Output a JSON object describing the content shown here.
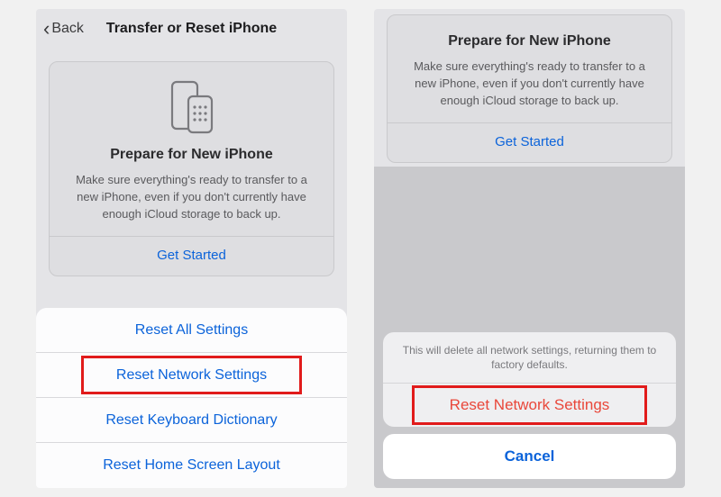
{
  "left": {
    "back_label": "Back",
    "title": "Transfer or Reset iPhone",
    "card": {
      "title": "Prepare for New iPhone",
      "desc": "Make sure everything's ready to transfer to a new iPhone, even if you don't currently have enough iCloud storage to back up.",
      "get_started": "Get Started"
    },
    "sheet": [
      "Reset All Settings",
      "Reset Network Settings",
      "Reset Keyboard Dictionary",
      "Reset Home Screen Layout"
    ]
  },
  "right": {
    "card": {
      "title": "Prepare for New iPhone",
      "desc": "Make sure everything's ready to transfer to a new iPhone, even if you don't currently have enough iCloud storage to back up.",
      "get_started": "Get Started"
    },
    "confirm": {
      "message": "This will delete all network settings, returning them to factory defaults.",
      "action": "Reset Network Settings",
      "cancel": "Cancel"
    }
  }
}
